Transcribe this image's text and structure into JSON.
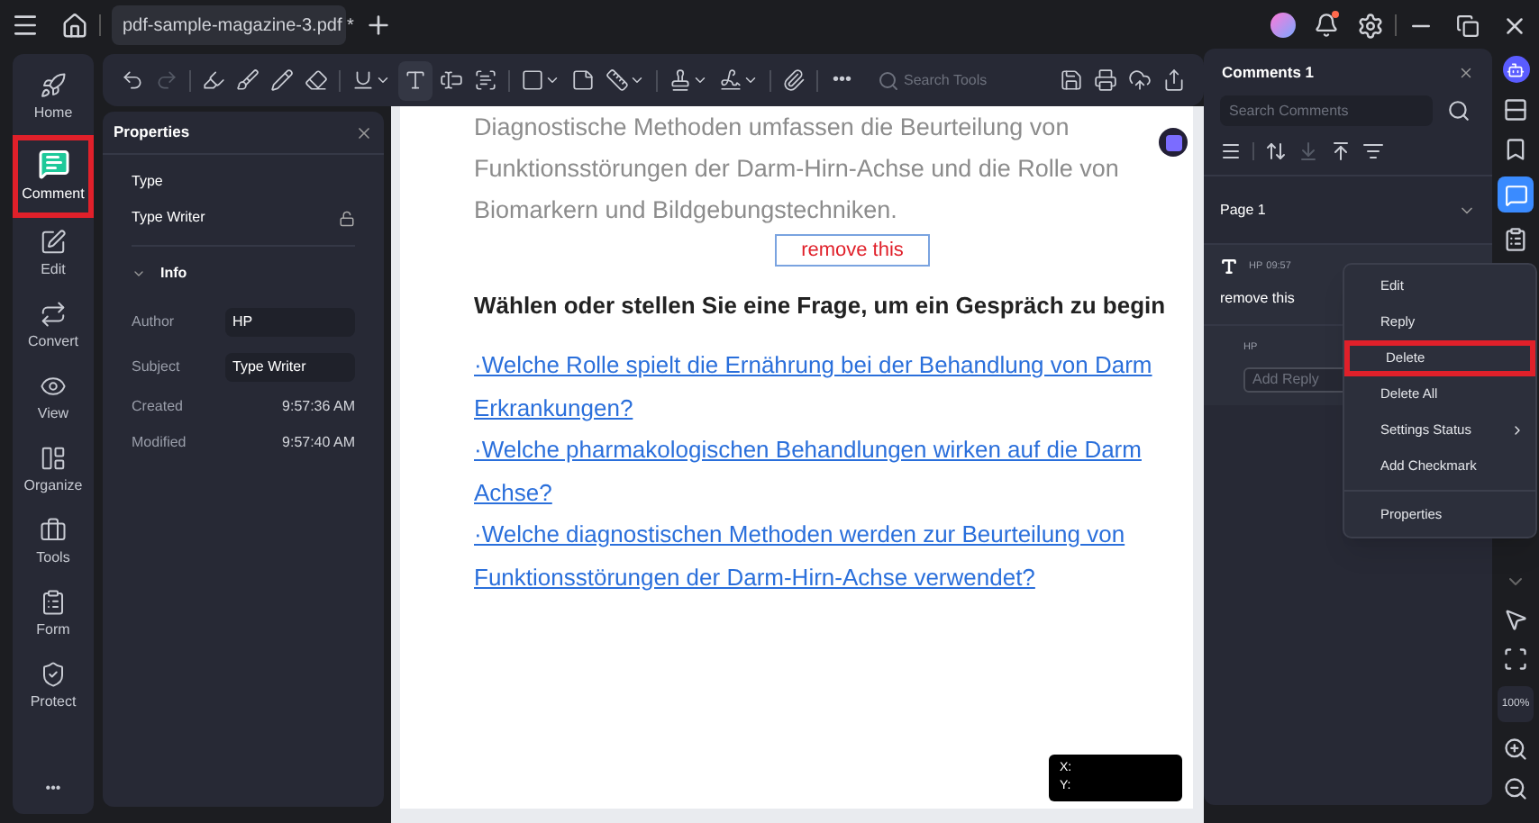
{
  "title_bar": {
    "tab_title": "pdf-sample-magazine-3.pdf *"
  },
  "nav": {
    "items": [
      {
        "label": "Home",
        "selected": false,
        "highlighted": false
      },
      {
        "label": "Comment",
        "selected": true,
        "highlighted": true
      },
      {
        "label": "Edit",
        "selected": false,
        "highlighted": false
      },
      {
        "label": "Convert",
        "selected": false,
        "highlighted": false
      },
      {
        "label": "View",
        "selected": false,
        "highlighted": false
      },
      {
        "label": "Organize",
        "selected": false,
        "highlighted": false
      },
      {
        "label": "Tools",
        "selected": false,
        "highlighted": false
      },
      {
        "label": "Form",
        "selected": false,
        "highlighted": false
      },
      {
        "label": "Protect",
        "selected": false,
        "highlighted": false
      }
    ],
    "more": "•••"
  },
  "toolbar": {
    "more": "•••",
    "search_placeholder": "Search Tools"
  },
  "properties": {
    "title": "Properties",
    "type_label": "Type",
    "type_value": "Type Writer",
    "info_label": "Info",
    "fields": [
      {
        "kind": "field",
        "label": "Author",
        "value": "HP"
      },
      {
        "kind": "field",
        "label": "Subject",
        "value": "Type Writer"
      },
      {
        "kind": "text",
        "label": "Created",
        "value": "9:57:36 AM"
      },
      {
        "kind": "text",
        "label": "Modified",
        "value": "9:57:40 AM"
      }
    ]
  },
  "document": {
    "paragraph_lines": [
      "Diagnostische Methoden umfassen die Beurteilung von",
      "Funktionsstörungen der Darm-Hirn-Achse und die Rolle von",
      "Biomarkern und Bildgebungstechniken."
    ],
    "annotation": "remove this",
    "heading": "Wählen oder stellen Sie eine Frage, um ein Gespräch zu begin",
    "link_lines": [
      "·Welche Rolle spielt die Ernährung bei der Behandlung von Darm",
      "Erkrankungen?",
      "·Welche pharmakologischen Behandlungen wirken auf die Darm",
      "Achse?",
      "·Welche diagnostischen Methoden werden zur Beurteilung von",
      "Funktionsstörungen der Darm-Hirn-Achse verwendet?"
    ],
    "coords": [
      "X:",
      "Y:"
    ]
  },
  "comments": {
    "title": "Comments 1",
    "search_placeholder": "Search Comments",
    "page_label": "Page 1",
    "comment": {
      "author": "HP",
      "time": "09:57",
      "text": "remove this"
    },
    "reply": {
      "author": "HP",
      "placeholder": "Add Reply"
    }
  },
  "context_menu": {
    "items": [
      {
        "label": "Edit",
        "highlighted": false,
        "submenu": false
      },
      {
        "label": "Reply",
        "highlighted": false,
        "submenu": false
      },
      {
        "label": "Delete",
        "highlighted": true,
        "submenu": false
      },
      {
        "label": "Delete All",
        "highlighted": false,
        "submenu": false
      },
      {
        "label": "Settings Status",
        "highlighted": false,
        "submenu": true
      },
      {
        "label": "Add Checkmark",
        "highlighted": false,
        "submenu": false
      },
      {
        "label": "Properties",
        "highlighted": false,
        "submenu": false
      }
    ]
  },
  "right_rail": {
    "comments_selected": true,
    "zoom": "100%"
  }
}
